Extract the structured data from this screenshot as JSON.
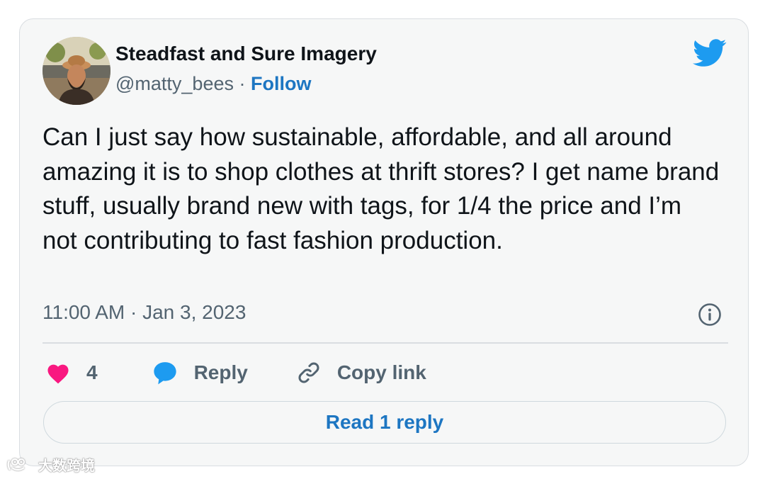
{
  "tweet": {
    "author": {
      "display_name": "Steadfast and Sure Imagery",
      "handle": "@matty_bees",
      "separator": " · ",
      "follow_label": "Follow"
    },
    "text": "Can I just say how sustainable, affordable, and all around amazing it is to shop clothes at thrift stores? I get name brand stuff, usually brand new with tags, for 1/4 the price and I’m not contributing to fast fashion production.",
    "timestamp": "11:00 AM · Jan 3, 2023",
    "actions": {
      "like_count": "4",
      "reply_label": "Reply",
      "copy_link_label": "Copy link"
    },
    "read_replies_label": "Read 1 reply"
  },
  "watermark": {
    "text": "大数跨境"
  },
  "icons": {
    "platform": "twitter-bird-icon",
    "info": "info-icon",
    "like": "heart-icon",
    "reply": "speech-bubble-icon",
    "copy": "link-icon"
  },
  "colors": {
    "brand": "#1d9bf0",
    "link": "#1d76c2",
    "heart": "#f91880",
    "text": "#0f1419",
    "muted": "#536471",
    "card_bg": "#f6f7f7"
  }
}
